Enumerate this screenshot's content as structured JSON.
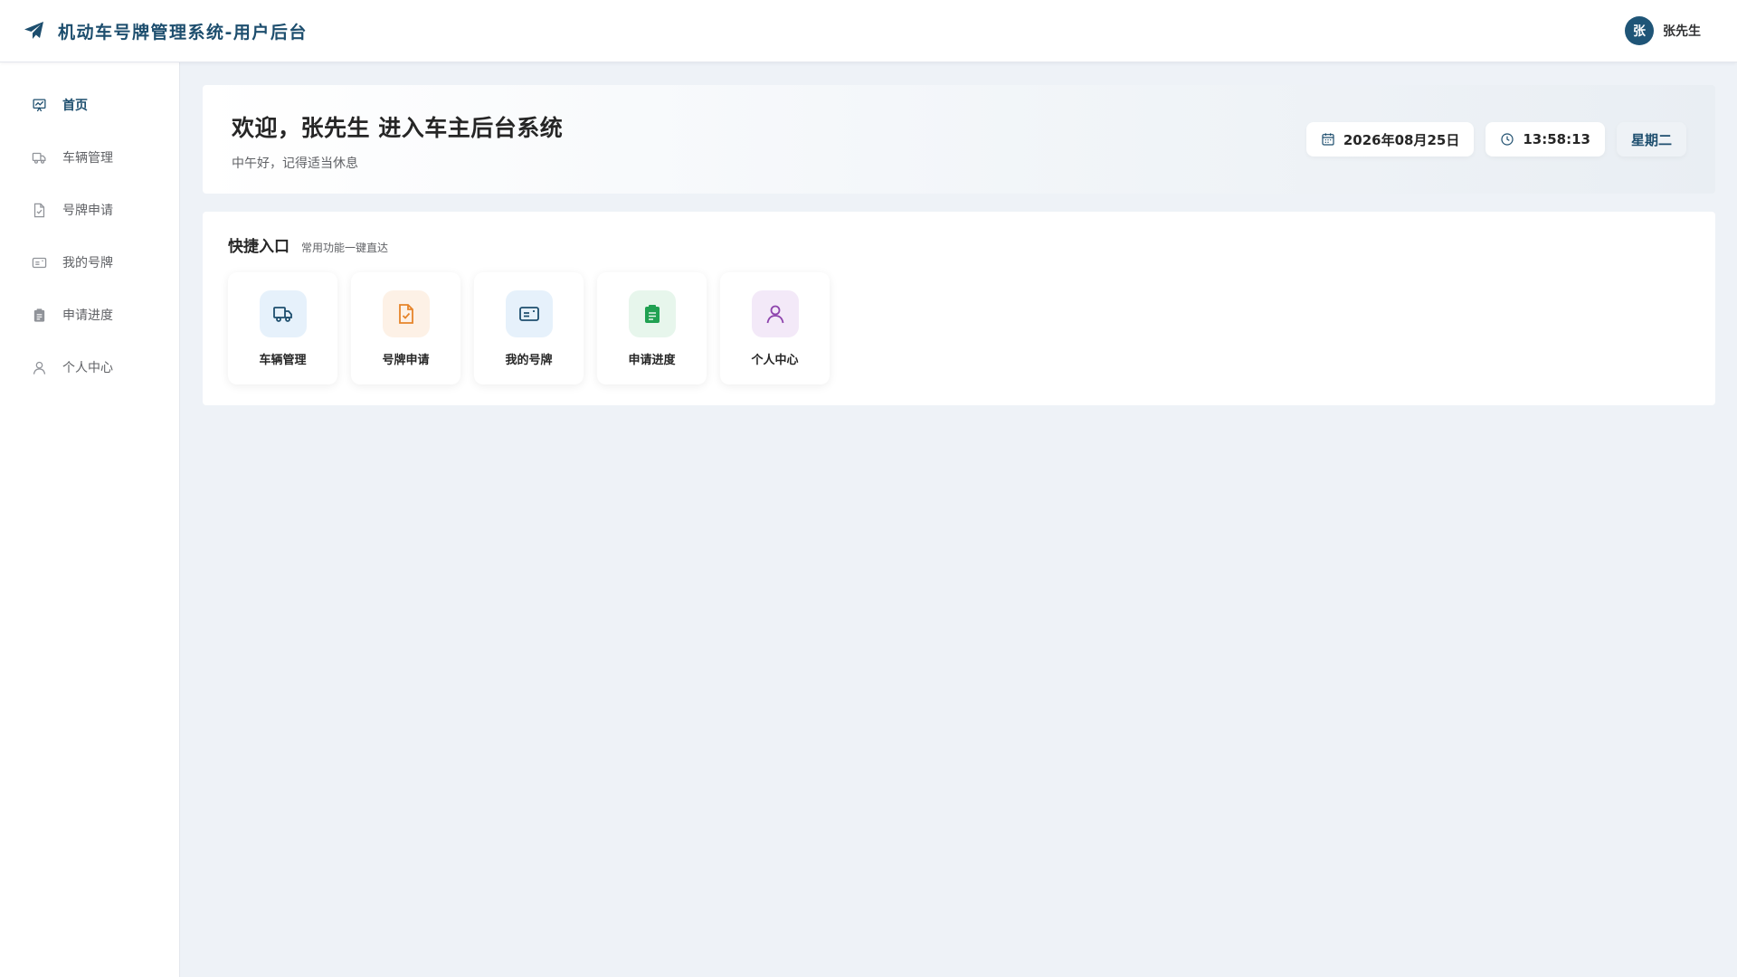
{
  "header": {
    "title": "机动车号牌管理系统-用户后台",
    "logo_icon": "paper-plane-icon",
    "user": {
      "avatar_text": "张",
      "name": "张先生"
    }
  },
  "sidebar": {
    "items": [
      {
        "label": "首页",
        "icon": "dashboard-chart-icon",
        "active": true
      },
      {
        "label": "车辆管理",
        "icon": "truck-icon",
        "active": false
      },
      {
        "label": "号牌申请",
        "icon": "document-check-icon",
        "active": false
      },
      {
        "label": "我的号牌",
        "icon": "card-icon",
        "active": false
      },
      {
        "label": "申请进度",
        "icon": "clipboard-icon",
        "active": false
      },
      {
        "label": "个人中心",
        "icon": "user-icon",
        "active": false
      }
    ]
  },
  "welcome": {
    "title": "欢迎，张先生 进入车主后台系统",
    "subtitle": "中午好，记得适当休息",
    "date": "2026年08月25日",
    "time": "13:58:13",
    "weekday": "星期二"
  },
  "quick": {
    "title": "快捷入口",
    "subtitle": "常用功能一键直达",
    "cards": [
      {
        "label": "车辆管理",
        "icon": "truck-icon",
        "color": "#1d4e6e",
        "bg": "#e6f1fb"
      },
      {
        "label": "号牌申请",
        "icon": "document-check-icon",
        "color": "#e6842a",
        "bg": "#fdf1e6"
      },
      {
        "label": "我的号牌",
        "icon": "card-icon",
        "color": "#1d4e6e",
        "bg": "#e6f1fb"
      },
      {
        "label": "申请进度",
        "icon": "clipboard-icon",
        "color": "#21a152",
        "bg": "#e7f6ec"
      },
      {
        "label": "个人中心",
        "icon": "user-icon",
        "color": "#8e44ad",
        "bg": "#f3e9f8"
      }
    ]
  },
  "colors": {
    "brand": "#1d4e6e",
    "background": "#eef2f7"
  }
}
